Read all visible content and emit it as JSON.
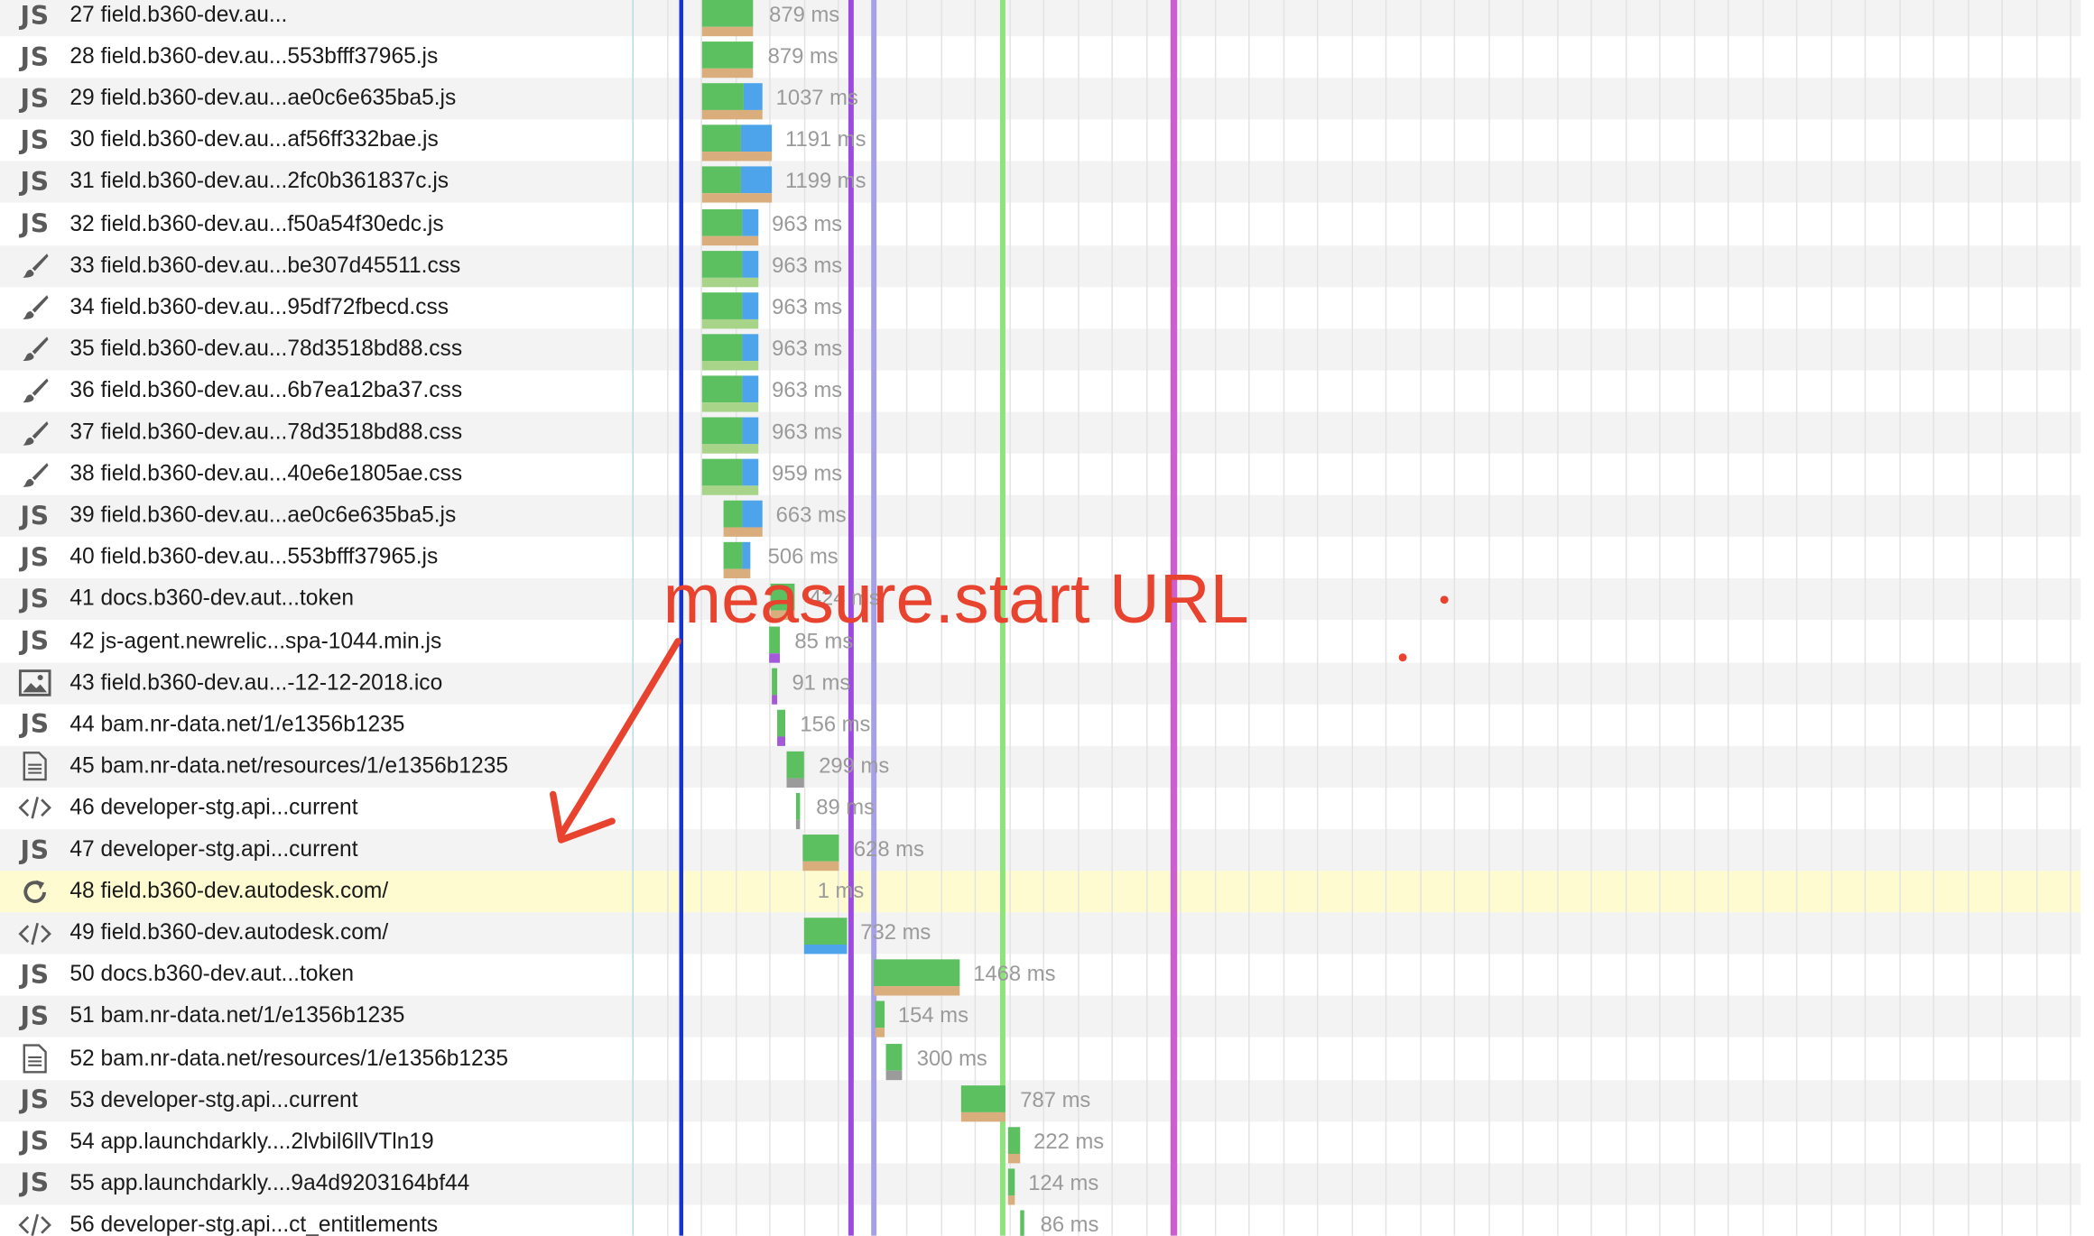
{
  "annotation": {
    "text": "measure.start URL"
  },
  "rows": [
    {
      "icon": "js",
      "label": "27 field.b360-dev.au...",
      "duration": "879 ms"
    },
    {
      "icon": "js",
      "label": "28 field.b360-dev.au...553bfff37965.js",
      "duration": "879 ms"
    },
    {
      "icon": "js",
      "label": "29 field.b360-dev.au...ae0c6e635ba5.js",
      "duration": "1037 ms"
    },
    {
      "icon": "js",
      "label": "30 field.b360-dev.au...af56ff332bae.js",
      "duration": "1191 ms"
    },
    {
      "icon": "js",
      "label": "31 field.b360-dev.au...2fc0b361837c.js",
      "duration": "1199 ms"
    },
    {
      "icon": "js",
      "label": "32 field.b360-dev.au...f50a54f30edc.js",
      "duration": "963 ms"
    },
    {
      "icon": "css",
      "label": "33 field.b360-dev.au...be307d45511.css",
      "duration": "963 ms"
    },
    {
      "icon": "css",
      "label": "34 field.b360-dev.au...95df72fbecd.css",
      "duration": "963 ms"
    },
    {
      "icon": "css",
      "label": "35 field.b360-dev.au...78d3518bd88.css",
      "duration": "963 ms"
    },
    {
      "icon": "css",
      "label": "36 field.b360-dev.au...6b7ea12ba37.css",
      "duration": "963 ms"
    },
    {
      "icon": "css",
      "label": "37 field.b360-dev.au...78d3518bd88.css",
      "duration": "963 ms"
    },
    {
      "icon": "css",
      "label": "38 field.b360-dev.au...40e6e1805ae.css",
      "duration": "959 ms"
    },
    {
      "icon": "js",
      "label": "39 field.b360-dev.au...ae0c6e635ba5.js",
      "duration": "663 ms"
    },
    {
      "icon": "js",
      "label": "40 field.b360-dev.au...553bfff37965.js",
      "duration": "506 ms"
    },
    {
      "icon": "js",
      "label": "41 docs.b360-dev.aut...token",
      "duration": "424 ms"
    },
    {
      "icon": "js",
      "label": "42 js-agent.newrelic...spa-1044.min.js",
      "duration": "85 ms"
    },
    {
      "icon": "image",
      "label": "43 field.b360-dev.au...-12-12-2018.ico",
      "duration": "91 ms"
    },
    {
      "icon": "js",
      "label": "44 bam.nr-data.net/1/e1356b1235",
      "duration": "156 ms"
    },
    {
      "icon": "doc",
      "label": "45 bam.nr-data.net/resources/1/e1356b1235",
      "duration": "299 ms"
    },
    {
      "icon": "code",
      "label": "46 developer-stg.api...current",
      "duration": "89 ms"
    },
    {
      "icon": "js",
      "label": "47 developer-stg.api...current",
      "duration": "628 ms"
    },
    {
      "icon": "reload",
      "label": "48 field.b360-dev.autodesk.com/",
      "duration": "1 ms"
    },
    {
      "icon": "code",
      "label": "49 field.b360-dev.autodesk.com/",
      "duration": "732 ms"
    },
    {
      "icon": "js",
      "label": "50 docs.b360-dev.aut...token",
      "duration": "1468 ms"
    },
    {
      "icon": "js",
      "label": "51 bam.nr-data.net/1/e1356b1235",
      "duration": "154 ms"
    },
    {
      "icon": "doc",
      "label": "52 bam.nr-data.net/resources/1/e1356b1235",
      "duration": "300 ms"
    },
    {
      "icon": "js",
      "label": "53 developer-stg.api...current",
      "duration": "787 ms"
    },
    {
      "icon": "js",
      "label": "54 app.launchdarkly....2lvbil6llVTln19",
      "duration": "222 ms"
    },
    {
      "icon": "js",
      "label": "55 app.launchdarkly....9a4d9203164bf44",
      "duration": "124 ms"
    },
    {
      "icon": "code",
      "label": "56 developer-stg.api...ct_entitlements",
      "duration": "86 ms"
    },
    {
      "icon": "js",
      "label": "",
      "duration": ""
    }
  ],
  "icon_glyphs": {
    "js": "JS",
    "css": "✎",
    "image": "▣",
    "doc": "▤",
    "code": "</>",
    "reload": "↻"
  },
  "colors": {
    "connect": "#5cbf60",
    "ttfb": "#4ea4ea",
    "download": "#d9ad7c",
    "css_download": "#a8d48a",
    "dns": "#9b9b9b",
    "purple": "#a359d8",
    "marker_blue": "#1532d6",
    "marker_purple": "#9b4be0",
    "marker_lilac": "#a6a0e8",
    "marker_green": "#8ee37c",
    "marker_magenta": "#cc5fcf",
    "annotation": "#e8432e",
    "highlight": "#fefbd0"
  }
}
